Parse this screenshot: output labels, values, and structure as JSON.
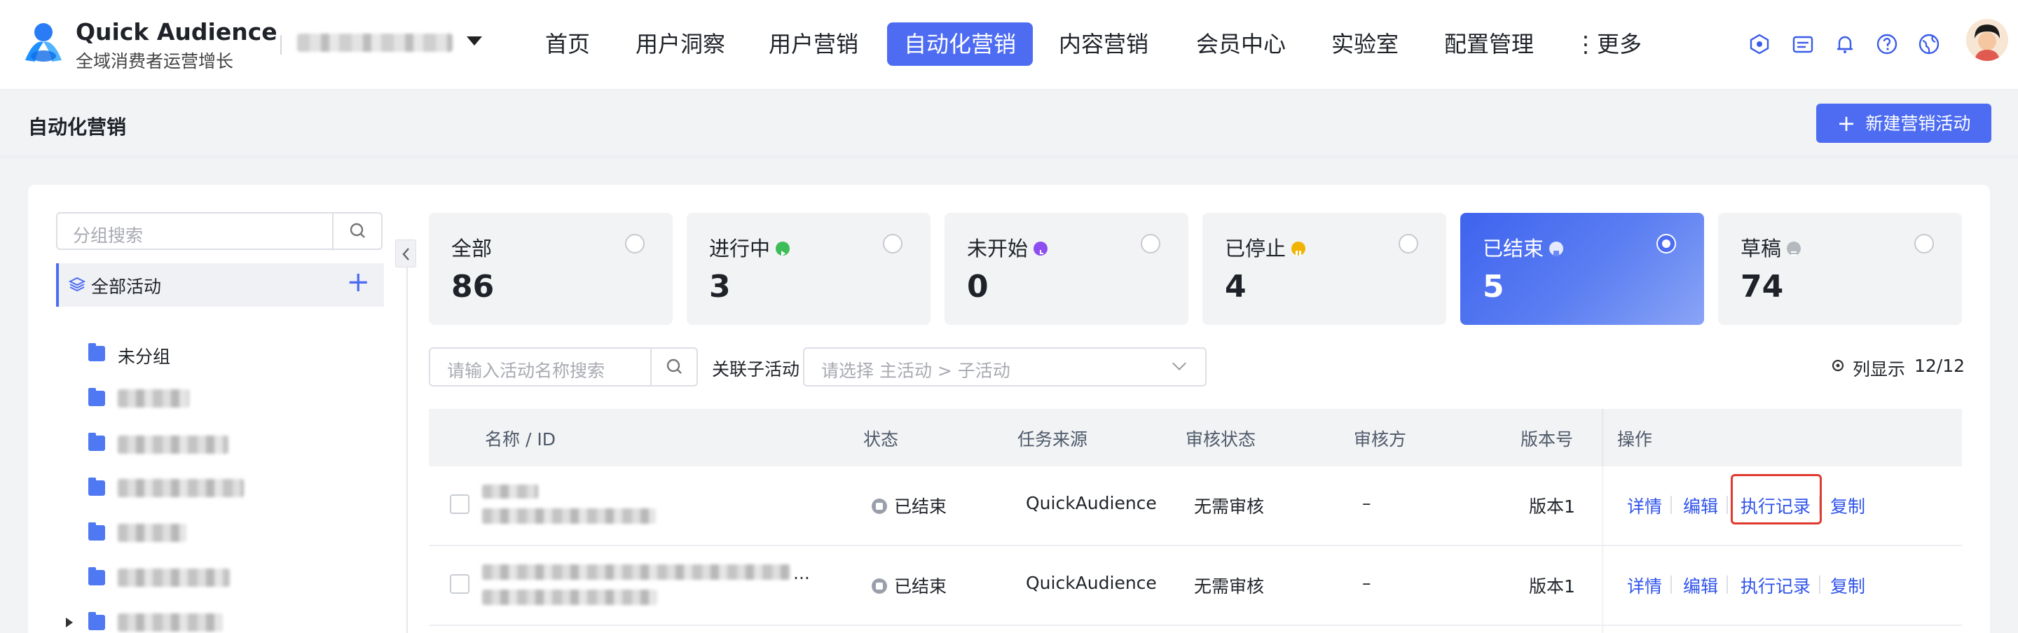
{
  "app": {
    "name": "Quick Audience",
    "subtitle": "全域消费者运营增长"
  },
  "nav": {
    "items": [
      "首页",
      "用户洞察",
      "用户营销",
      "自动化营销",
      "内容营销",
      "会员中心",
      "实验室",
      "配置管理",
      "更多"
    ],
    "active": "自动化营销",
    "more_prefix": "⋮"
  },
  "toolbar_icons": [
    "data-app-icon",
    "message-icon",
    "bell-icon",
    "help-icon",
    "globe-icon"
  ],
  "page": {
    "title": "自动化营销",
    "new_button": "新建营销活动"
  },
  "groups": {
    "search_placeholder": "分组搜索",
    "all_label": "全部活动",
    "ungrouped": "未分组"
  },
  "stats": [
    {
      "label": "全部",
      "count": "86",
      "dot": ""
    },
    {
      "label": "进行中",
      "count": "3",
      "dot": "#3dbd5a"
    },
    {
      "label": "未开始",
      "count": "0",
      "dot": "#8d4ef0"
    },
    {
      "label": "已停止",
      "count": "4",
      "dot": "#f0b400"
    },
    {
      "label": "已结束",
      "count": "5",
      "dot": "#ffffff"
    },
    {
      "label": "草稿",
      "count": "74",
      "dot": "#b4b8bf"
    }
  ],
  "stats_active": "已结束",
  "filters": {
    "search_placeholder": "请输入活动名称搜索",
    "sub_label": "关联子活动",
    "sub_placeholder": "请选择 主活动 > 子活动",
    "column_display": "列显示",
    "column_count": "12/12"
  },
  "table": {
    "headers": [
      "名称 / ID",
      "状态",
      "任务来源",
      "审核状态",
      "审核方",
      "版本号",
      "操作"
    ],
    "rows": [
      {
        "status": "已结束",
        "source": "QuickAudience",
        "review": "无需审核",
        "reviewer": "–",
        "version": "版本1"
      },
      {
        "status": "已结束",
        "source": "QuickAudience",
        "review": "无需审核",
        "reviewer": "–",
        "version": "版本1"
      }
    ],
    "actions": [
      "详情",
      "编辑",
      "执行记录",
      "复制"
    ],
    "row2_name_suffix": "..."
  },
  "colors": {
    "accent": "#4d6cf2",
    "link": "#2f54eb",
    "highlight": "#e03a2f"
  }
}
